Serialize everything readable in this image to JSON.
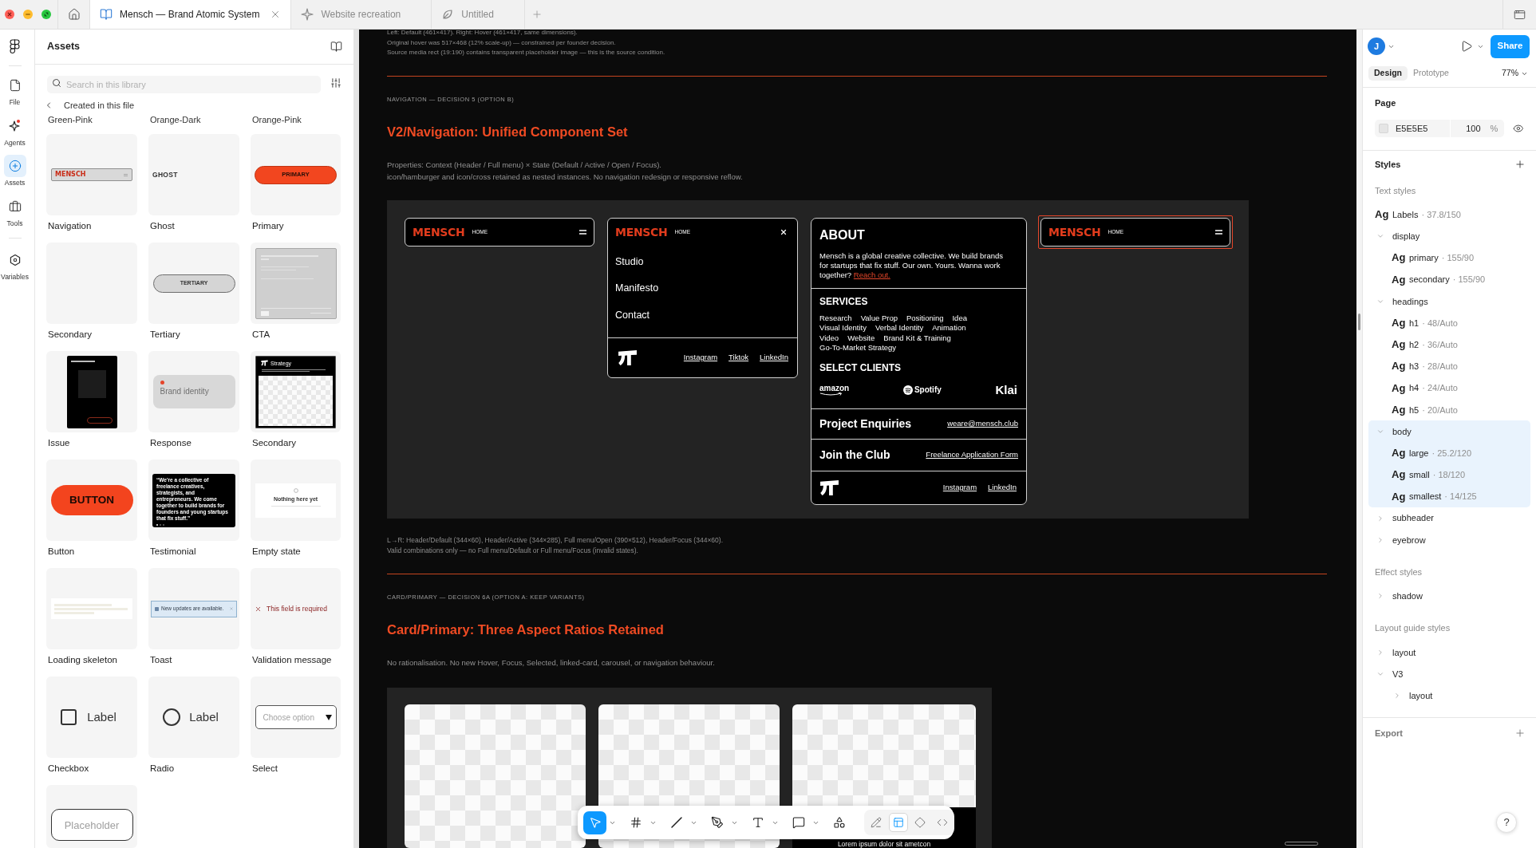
{
  "tab_bar": {
    "tabs": [
      {
        "label": "Mensch — Brand Atomic System",
        "kind": "design",
        "selected": true
      },
      {
        "label": "Website recreation",
        "kind": "whiteboard",
        "selected": false
      },
      {
        "label": "Untitled",
        "kind": "slides",
        "selected": false
      }
    ]
  },
  "tool_rail": {
    "items": [
      {
        "label": "File",
        "kind": "file",
        "selected": false,
        "notification": false
      },
      {
        "label": "Agents",
        "kind": "agents",
        "selected": false,
        "notification": true
      },
      {
        "label": "Assets",
        "kind": "assets",
        "selected": true,
        "notification": false
      },
      {
        "label": "Tools",
        "kind": "tools",
        "selected": false,
        "notification": false
      },
      {
        "label": "Variables",
        "kind": "variables",
        "selected": false,
        "notification": false
      }
    ]
  },
  "assets_panel": {
    "title": "Assets",
    "search": {
      "placeholder": "Search in this library"
    },
    "breadcrumb": "Created in this file",
    "partial_labels": [
      "Green-Pink",
      "Orange-Dark",
      "Orange-Pink"
    ],
    "items": [
      {
        "label": "Navigation",
        "kind": "navigation",
        "preview_text": "MENSCH"
      },
      {
        "label": "Ghost",
        "kind": "ghost",
        "preview_text": "GHOST"
      },
      {
        "label": "Primary",
        "kind": "primary",
        "preview_text": "PRIMARY"
      },
      {
        "label": "Secondary",
        "kind": "blank"
      },
      {
        "label": "Tertiary",
        "kind": "tertiary",
        "preview_text": "TERTIARY"
      },
      {
        "label": "CTA",
        "kind": "cta"
      },
      {
        "label": "Issue",
        "kind": "issue"
      },
      {
        "label": "Response",
        "kind": "response",
        "preview_text": "Brand identity"
      },
      {
        "label": "Secondary",
        "kind": "card",
        "preview_text": "Strategy"
      },
      {
        "label": "Button",
        "kind": "button",
        "preview_text": "BUTTON"
      },
      {
        "label": "Testimonial",
        "kind": "testimonial",
        "preview_text": "“We're a collective of freelance creatives, strategists, and entrepreneurs. We come together to build brands for founders and young startups that fix stuff.”"
      },
      {
        "label": "Empty state",
        "kind": "empty",
        "preview_text": "Nothing here yet"
      },
      {
        "label": "Loading skeleton",
        "kind": "skeleton"
      },
      {
        "label": "Toast",
        "kind": "toast",
        "preview_text": "New updates are available."
      },
      {
        "label": "Validation message",
        "kind": "validation",
        "preview_text": "This field is required"
      },
      {
        "label": "Checkbox",
        "kind": "checkbox",
        "preview_text": "Label",
        "checked": false
      },
      {
        "label": "Radio",
        "kind": "radio",
        "preview_text": "Label",
        "checked": false
      },
      {
        "label": "Select",
        "kind": "select",
        "preview_text": "Choose option"
      },
      {
        "kind": "input",
        "placeholder": "Placeholder"
      }
    ]
  },
  "canvas": {
    "intro_lines": [
      "Left: Default (461×417). Right: Hover (461×417, same dimensions).",
      "Original hover was 517×468 (12% scale-up) — constrained per founder decision.",
      "Source media rect (19:190) contains transparent placeholder image — this is the source condition."
    ],
    "navigation_section": {
      "eyebrow": "NAVIGATION — DECISION 5 (OPTION B)",
      "title": "V2/Navigation: Unified Component Set",
      "description": [
        "Properties: Context (Header / Full menu) × State (Default / Active / Open / Focus).",
        "icon/hamburger and icon/cross retained as nested instances. No navigation redesign or responsive reflow."
      ],
      "variants": [
        {
          "kind": "header",
          "logo": "MENSCH",
          "link": "HOME",
          "menu_open": false,
          "focused": false
        },
        {
          "kind": "header",
          "logo": "MENSCH",
          "link": "HOME",
          "menu_open": true,
          "focused": false,
          "menu_items": [
            "Studio",
            "Manifesto",
            "Contact"
          ],
          "social_links": [
            "Instagram",
            "Tiktok",
            "LinkedIn"
          ]
        },
        {
          "kind": "full_menu",
          "about": {
            "title": "ABOUT",
            "text": "Mensch is a global creative collective. We build brands for startups that fix stuff. Our own. Yours. Wanna work together?",
            "link": "Reach out."
          },
          "services": {
            "title": "SERVICES",
            "rows": [
              [
                "Research",
                "Value Prop",
                "Positioning",
                "Idea"
              ],
              [
                "Visual Identity",
                "Verbal Identity",
                "Animation"
              ],
              [
                "Video",
                "Website",
                "Brand Kit & Training"
              ],
              [
                "Go-To-Market Strategy"
              ]
            ]
          },
          "clients": {
            "title": "SELECT CLIENTS",
            "items": [
              {
                "name": "amazon",
                "kind": "smile"
              },
              {
                "name": "Spotify",
                "kind": "disc"
              },
              {
                "name": "Klai",
                "kind": "wordmark"
              }
            ]
          },
          "contacts": [
            {
              "title": "Project Enquiries",
              "link": "weare@mensch.club"
            },
            {
              "title": "Join the Club",
              "link": "Freelance Application Form"
            }
          ],
          "social_links": [
            "Instagram",
            "LinkedIn"
          ]
        },
        {
          "kind": "header",
          "logo": "MENSCH",
          "link": "HOME",
          "menu_open": false,
          "focused": true
        }
      ],
      "captions": [
        "L→R: Header/Default (344×60), Header/Active (344×285), Full menu/Open (390×512), Header/Focus (344×60).",
        "Valid combinations only — no Full menu/Default or Full menu/Focus (invalid states)."
      ]
    },
    "card_section": {
      "eyebrow": "CARD/PRIMARY — DECISION 6A (OPTION A: KEEP VARIANTS)",
      "title": "Card/Primary: Three Aspect Ratios Retained",
      "description": [
        "No rationalisation. No new Hover, Focus, Selected, linked-card, carousel, or navigation behaviour."
      ],
      "cards": [
        {
          "kind": "image"
        },
        {
          "kind": "image"
        },
        {
          "kind": "captioned",
          "caption": "Lorem ipsum dolor sit ametcon"
        }
      ]
    }
  },
  "toolbar": {
    "tools": [
      {
        "kind": "move",
        "selected": true,
        "dropdown": true
      },
      {
        "kind": "frame",
        "selected": false,
        "dropdown": true
      },
      {
        "kind": "line",
        "selected": false,
        "dropdown": true
      },
      {
        "kind": "pen",
        "selected": false,
        "dropdown": true
      },
      {
        "kind": "text",
        "selected": false,
        "dropdown": true
      },
      {
        "kind": "note",
        "selected": false,
        "dropdown": true
      },
      {
        "kind": "actions",
        "selected": false,
        "dropdown": false
      }
    ],
    "modes": [
      {
        "kind": "draw",
        "selected": false
      },
      {
        "kind": "design",
        "selected": true
      },
      {
        "kind": "prototype",
        "selected": false
      },
      {
        "kind": "dev",
        "selected": false
      }
    ]
  },
  "inspector": {
    "user_initial": "J",
    "share": "Share",
    "tabs": [
      {
        "label": "Design",
        "selected": true
      },
      {
        "label": "Prototype",
        "selected": false
      }
    ],
    "zoom": "77%",
    "page": {
      "title": "Page",
      "color": "E5E5E5",
      "opacity": "100",
      "unit": "%"
    },
    "styles": {
      "title": "Styles",
      "text_styles": {
        "title": "Text styles",
        "items": [
          {
            "kind": "style",
            "sample": "Ag",
            "name": "Labels",
            "spec": "· 37.8/150",
            "selected": false
          },
          {
            "kind": "group",
            "name": "display",
            "expanded": true,
            "selected": false,
            "children": [
              {
                "kind": "style",
                "sample": "Ag",
                "name": "primary",
                "spec": "· 155/90",
                "selected": false
              },
              {
                "kind": "style",
                "sample": "Ag",
                "name": "secondary",
                "spec": "· 155/90",
                "selected": false
              }
            ]
          },
          {
            "kind": "group",
            "name": "headings",
            "expanded": true,
            "selected": false,
            "children": [
              {
                "kind": "style",
                "sample": "Ag",
                "name": "h1",
                "spec": "· 48/Auto",
                "selected": false
              },
              {
                "kind": "style",
                "sample": "Ag",
                "name": "h2",
                "spec": "· 36/Auto",
                "selected": false
              },
              {
                "kind": "style",
                "sample": "Ag",
                "name": "h3",
                "spec": "· 28/Auto",
                "selected": false
              },
              {
                "kind": "style",
                "sample": "Ag",
                "name": "h4",
                "spec": "· 24/Auto",
                "selected": false
              },
              {
                "kind": "style",
                "sample": "Ag",
                "name": "h5",
                "spec": "· 20/Auto",
                "selected": false
              }
            ]
          },
          {
            "kind": "group",
            "name": "body",
            "expanded": true,
            "selected": true,
            "children": [
              {
                "kind": "style",
                "sample": "Ag",
                "name": "large",
                "spec": "· 25.2/120",
                "selected": false
              },
              {
                "kind": "style",
                "sample": "Ag",
                "name": "small",
                "spec": "· 18/120",
                "selected": false
              },
              {
                "kind": "style",
                "sample": "Ag",
                "name": "smallest",
                "spec": "· 14/125",
                "selected": false
              }
            ]
          },
          {
            "kind": "group",
            "name": "subheader",
            "expanded": false,
            "selected": false
          },
          {
            "kind": "group",
            "name": "eyebrow",
            "expanded": false,
            "selected": false
          }
        ]
      },
      "effect_styles": {
        "title": "Effect styles",
        "items": [
          {
            "kind": "group",
            "name": "shadow",
            "expanded": false,
            "selected": false
          }
        ]
      },
      "layout_guide_styles": {
        "title": "Layout guide styles",
        "items": [
          {
            "kind": "group",
            "name": "layout",
            "expanded": false,
            "selected": false
          },
          {
            "kind": "group",
            "name": "V3",
            "expanded": true,
            "selected": false,
            "children": [
              {
                "kind": "group",
                "name": "layout",
                "expanded": false,
                "selected": false
              }
            ]
          }
        ]
      }
    },
    "export": "Export",
    "help": "?"
  }
}
